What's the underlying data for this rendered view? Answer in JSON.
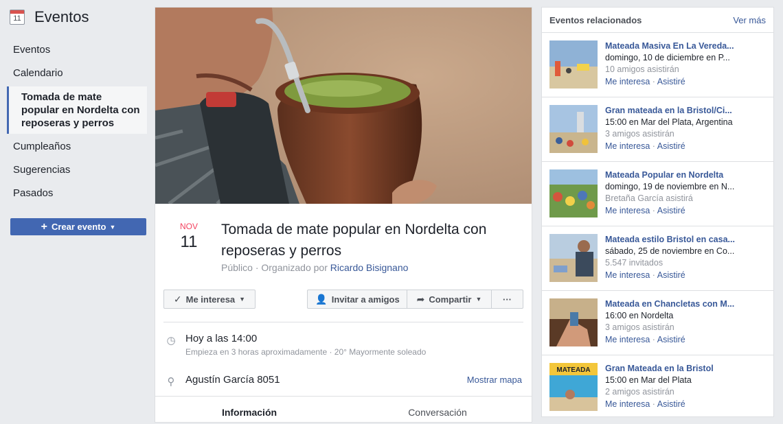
{
  "app": {
    "title": "Eventos",
    "calendar_day": "11"
  },
  "sidebar": {
    "items": [
      {
        "label": "Eventos"
      },
      {
        "label": "Calendario"
      },
      {
        "label": "Tomada de mate popular en Nordelta con reposeras y perros",
        "active": true
      },
      {
        "label": "Cumpleaños"
      },
      {
        "label": "Sugerencias"
      },
      {
        "label": "Pasados"
      }
    ],
    "create_label": "Crear evento"
  },
  "event": {
    "month": "NOV",
    "day": "11",
    "title": "Tomada de mate popular en Nordelta con reposeras y perros",
    "privacy": "Público",
    "organized_by": "Organizado por",
    "organizer": "Ricardo Bisignano",
    "actions": {
      "interest": "Me interesa",
      "invite": "Invitar a amigos",
      "share": "Compartir",
      "more": "···"
    },
    "time_main": "Hoy a las 14:00",
    "time_sub": "Empieza en 3 horas aproximadamente · 20° Mayormente soleado",
    "location": "Agustín García 8051",
    "map_link": "Mostrar mapa",
    "tabs": [
      "Información",
      "Conversación"
    ]
  },
  "related": {
    "title": "Eventos relacionados",
    "more": "Ver más",
    "interest_label": "Me interesa",
    "attend_label": "Asistiré",
    "items": [
      {
        "name": "Mateada Masiva En La Vereda...",
        "when": "domingo, 10 de diciembre en P...",
        "who": "10 amigos asistirán"
      },
      {
        "name": "Gran mateada en la Bristol/Ci...",
        "when": "15:00 en Mar del Plata, Argentina",
        "who": "3 amigos asistirán"
      },
      {
        "name": "Mateada Popular en Nordelta",
        "when": "domingo, 19 de noviembre en N...",
        "who": "Bretaña García asistirá"
      },
      {
        "name": "Mateada estilo Bristol en casa...",
        "when": "sábado, 25 de noviembre en Co...",
        "who": "5.547 invitados"
      },
      {
        "name": "Mateada en Chancletas con M...",
        "when": "16:00 en Nordelta",
        "who": "3 amigos asistirán"
      },
      {
        "name": "Gran Mateada en la Bristol",
        "when": "15:00 en Mar del Plata",
        "who": "2 amigos asistirán",
        "thumb_text": "MATEADA"
      }
    ]
  },
  "colors": {
    "accent": "#4267b2",
    "link": "#385898",
    "month": "#f3425f"
  }
}
